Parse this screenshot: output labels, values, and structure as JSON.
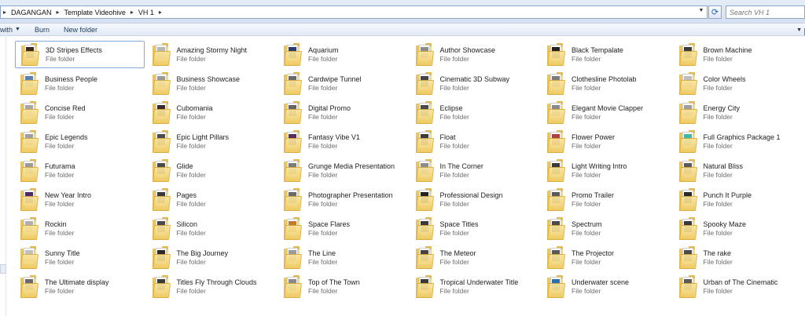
{
  "address": {
    "crumbs": [
      "DAGANGAN",
      "Template Videohive",
      "VH 1"
    ]
  },
  "search": {
    "placeholder": "Search VH 1"
  },
  "toolbar": {
    "share_label": "with",
    "burn_label": "Burn",
    "new_folder_label": "New folder"
  },
  "colors": {
    "accent": "#84acdd",
    "folder": "#efcb62"
  },
  "folders": [
    {
      "name": "3D Stripes Effects",
      "type": "File folder",
      "thumb": "#3a2a1c",
      "selected": true
    },
    {
      "name": "Amazing Stormy Night",
      "type": "File folder",
      "thumb": "#b6b6b6"
    },
    {
      "name": "Aquarium",
      "type": "File folder",
      "thumb": "#2a3d6b"
    },
    {
      "name": "Author Showcase",
      "type": "File folder",
      "thumb": "#8b8b8b"
    },
    {
      "name": "Black Tempalate",
      "type": "File folder",
      "thumb": "#222222"
    },
    {
      "name": "Brown Machine",
      "type": "File folder",
      "thumb": "#3b3b3b"
    },
    {
      "name": "Business People",
      "type": "File folder",
      "thumb": "#5a7fb0"
    },
    {
      "name": "Business Showcase",
      "type": "File folder",
      "thumb": "#9a9a9a"
    },
    {
      "name": "Cardwipe Tunnel",
      "type": "File folder",
      "thumb": "#6a6a6a"
    },
    {
      "name": "Cinematic 3D Subway",
      "type": "File folder",
      "thumb": "#444444"
    },
    {
      "name": "Clothesline Photolab",
      "type": "File folder",
      "thumb": "#7c7c7c"
    },
    {
      "name": "Color Wheels",
      "type": "File folder",
      "thumb": "#bdbdbd"
    },
    {
      "name": "Concise Red",
      "type": "File folder",
      "thumb": "#a8a8a8"
    },
    {
      "name": "Cubomania",
      "type": "File folder",
      "thumb": "#3a2a2a"
    },
    {
      "name": "Digital Promo",
      "type": "File folder",
      "thumb": "#666666"
    },
    {
      "name": "Eclipse",
      "type": "File folder",
      "thumb": "#4a4a4a"
    },
    {
      "name": "Elegant Movie Clapper",
      "type": "File folder",
      "thumb": "#8a8a8a"
    },
    {
      "name": "Energy City",
      "type": "File folder",
      "thumb": "#9e9e9e"
    },
    {
      "name": "Epic Legends",
      "type": "File folder",
      "thumb": "#a0a0a0"
    },
    {
      "name": "Epic Light Pillars",
      "type": "File folder",
      "thumb": "#4c4c4c"
    },
    {
      "name": "Fantasy Vibe V1",
      "type": "File folder",
      "thumb": "#5a2a5c"
    },
    {
      "name": "Float",
      "type": "File folder",
      "thumb": "#3a3a3a"
    },
    {
      "name": "Flower Power",
      "type": "File folder",
      "thumb": "#b04040"
    },
    {
      "name": "Full Graphics Package 1",
      "type": "File folder",
      "thumb": "#3fb8a8"
    },
    {
      "name": "Futurama",
      "type": "File folder",
      "thumb": "#9a9a9a"
    },
    {
      "name": "Glide",
      "type": "File folder",
      "thumb": "#4a4a4a"
    },
    {
      "name": "Grunge Media Presentation",
      "type": "File folder",
      "thumb": "#7a7a7a"
    },
    {
      "name": "In The Corner",
      "type": "File folder",
      "thumb": "#8c8c8c"
    },
    {
      "name": "Light Writing Intro",
      "type": "File folder",
      "thumb": "#3a3a3a"
    },
    {
      "name": "Natural Bliss",
      "type": "File folder",
      "thumb": "#5a5a5a"
    },
    {
      "name": "New Year Intro",
      "type": "File folder",
      "thumb": "#4a2a6b"
    },
    {
      "name": "Pages",
      "type": "File folder",
      "thumb": "#3a3a3a"
    },
    {
      "name": "Photographer Presentation",
      "type": "File folder",
      "thumb": "#6a6a6a"
    },
    {
      "name": "Professional Design",
      "type": "File folder",
      "thumb": "#222222"
    },
    {
      "name": "Promo Trailer",
      "type": "File folder",
      "thumb": "#5a5a5a"
    },
    {
      "name": "Punch It Purple",
      "type": "File folder",
      "thumb": "#2a2a2a"
    },
    {
      "name": "Rockin",
      "type": "File folder",
      "thumb": "#b0b0b0"
    },
    {
      "name": "Silicon",
      "type": "File folder",
      "thumb": "#4a4a4a"
    },
    {
      "name": "Space Flares",
      "type": "File folder",
      "thumb": "#c27a2a"
    },
    {
      "name": "Space Titles",
      "type": "File folder",
      "thumb": "#3a3a3a"
    },
    {
      "name": "Spectrum",
      "type": "File folder",
      "thumb": "#4a4a4a"
    },
    {
      "name": "Spooky Maze",
      "type": "File folder",
      "thumb": "#3a3a3a"
    },
    {
      "name": "Sunny Title",
      "type": "File folder",
      "thumb": "#c0c0c0"
    },
    {
      "name": "The Big Journey",
      "type": "File folder",
      "thumb": "#2a2a2a"
    },
    {
      "name": "The Line",
      "type": "File folder",
      "thumb": "#9a9a9a"
    },
    {
      "name": "The Meteor",
      "type": "File folder",
      "thumb": "#444444"
    },
    {
      "name": "The Projector",
      "type": "File folder",
      "thumb": "#5a5a5a"
    },
    {
      "name": "The rake",
      "type": "File folder",
      "thumb": "#4a4a4a"
    },
    {
      "name": "The Ultimate display",
      "type": "File folder",
      "thumb": "#6a6a6a"
    },
    {
      "name": "Titles Fly Through Clouds",
      "type": "File folder",
      "thumb": "#3a3a3a"
    },
    {
      "name": "Top of The Town",
      "type": "File folder",
      "thumb": "#8a8a8a"
    },
    {
      "name": "Tropical Underwater Title",
      "type": "File folder",
      "thumb": "#3a3a3a"
    },
    {
      "name": "Underwater scene",
      "type": "File folder",
      "thumb": "#2a6fb0"
    },
    {
      "name": "Urban of The Cinematic",
      "type": "File folder",
      "thumb": "#5a5a5a"
    }
  ]
}
